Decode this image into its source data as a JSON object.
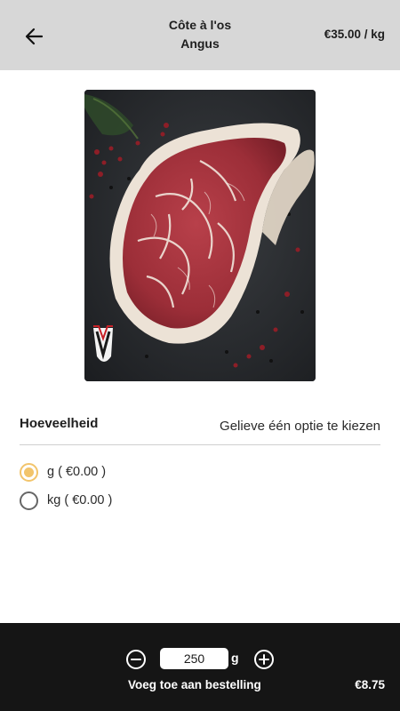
{
  "header": {
    "back_icon": "arrow-left-icon",
    "title_line1": "Côte à l'os",
    "title_line2": "Angus",
    "price": "€35.00 / kg"
  },
  "product": {
    "image_alt": "Côte à l'os Angus",
    "logo_letter": "V"
  },
  "options_section": {
    "label": "Hoeveelheid",
    "hint": "Gelieve één optie te kiezen",
    "options": [
      {
        "label": "g ( €0.00 )",
        "selected": true
      },
      {
        "label": "kg ( €0.00 )",
        "selected": false
      }
    ]
  },
  "footer": {
    "quantity": "250",
    "unit": "g",
    "minus_icon": "minus-circle-icon",
    "plus_icon": "plus-circle-icon",
    "add_label": "Voeg toe aan bestelling",
    "total": "€8.75"
  },
  "colors": {
    "header_bg": "#d7d7d7",
    "footer_bg": "#151515",
    "accent": "#f2c46b"
  }
}
